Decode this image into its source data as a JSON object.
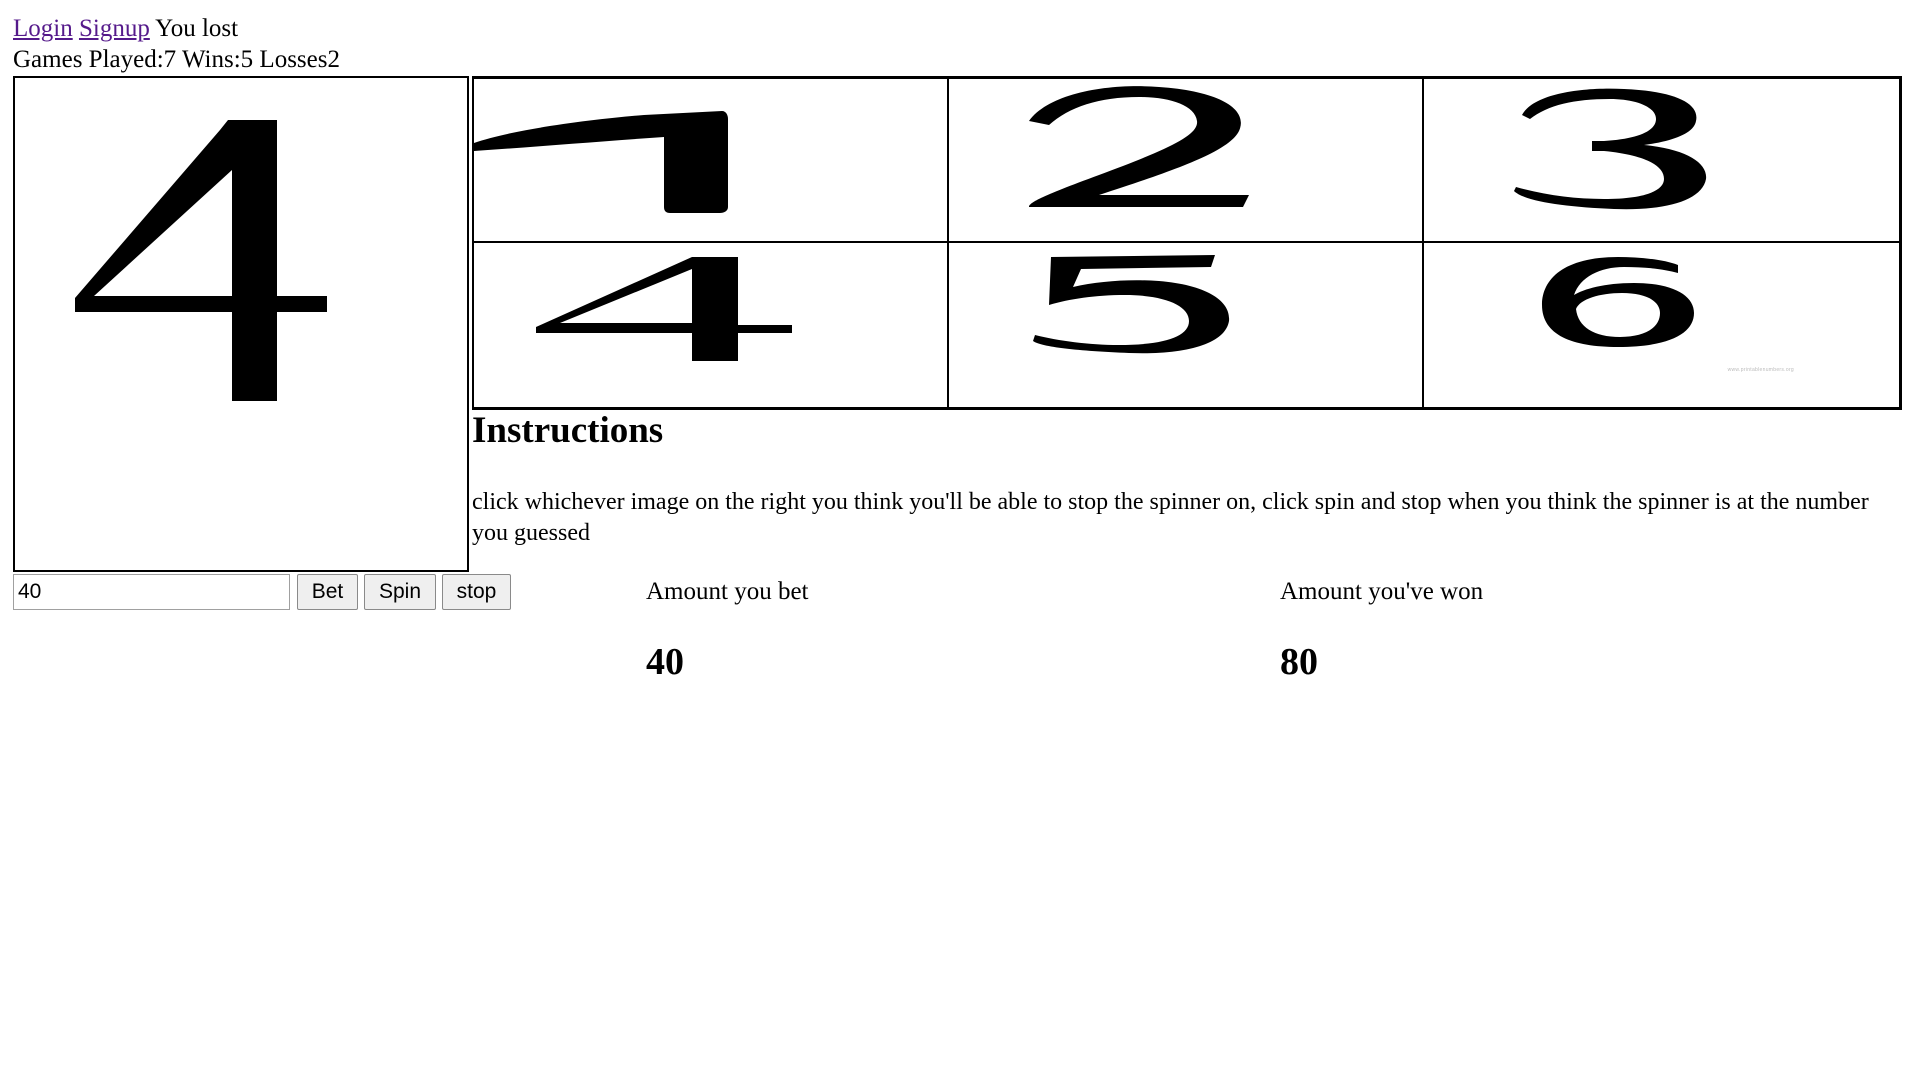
{
  "nav": {
    "login_label": "Login",
    "signup_label": "Signup",
    "status_text": "You lost"
  },
  "stats": {
    "text": "Games Played:7 Wins:5 Losses2"
  },
  "spinner": {
    "current_number": "4"
  },
  "options": {
    "cells": [
      "1",
      "2",
      "3",
      "4",
      "5",
      "6"
    ],
    "watermark": "www.printablenumbers.org"
  },
  "instructions": {
    "title": "Instructions",
    "text": "click whichever image on the right you think you'll be able to stop the spinner on, click spin and stop when you think the spinner is at the number you guessed"
  },
  "controls": {
    "bet_value": "40",
    "bet_label": "Bet",
    "spin_label": "Spin",
    "stop_label": "stop"
  },
  "results": {
    "bet_label": "Amount you bet",
    "bet_value": "40",
    "won_label": "Amount you've won",
    "won_value": "80"
  }
}
